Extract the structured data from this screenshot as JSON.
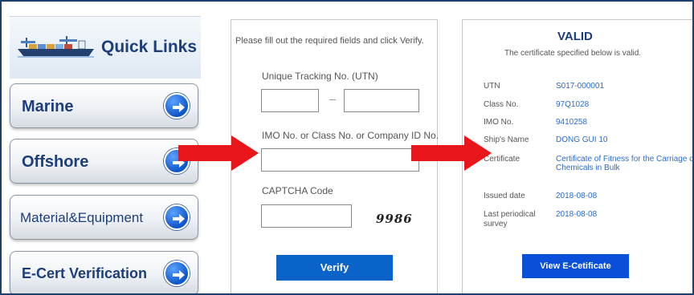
{
  "quick_links": {
    "title": "Quick Links",
    "items": [
      {
        "label": "Marine"
      },
      {
        "label": "Offshore"
      },
      {
        "label": "Material&Equipment"
      },
      {
        "label": "E-Cert Verification"
      }
    ]
  },
  "form": {
    "instruction": "Please fill out the required fields and click Verify.",
    "utn_label": "Unique Tracking No. (UTN)",
    "utn_dash": "–",
    "imo_label": "IMO No. or Class No. or Company ID No.",
    "captcha_label": "CAPTCHA Code",
    "captcha_code": "9986",
    "verify_label": "Verify"
  },
  "result": {
    "status": "VALID",
    "subtitle": "The certificate specified below is valid.",
    "rows": [
      {
        "key": "UTN",
        "value": "S017-000001"
      },
      {
        "key": "Class No.",
        "value": "97Q1028"
      },
      {
        "key": "IMO No.",
        "value": "9410258"
      },
      {
        "key": "Ship's Name",
        "value": "DONG GUI 10"
      },
      {
        "key": "Certificate",
        "value_line1": "Certificate of Fitness for the Carriage of",
        "value_line2": "Chemicals in Bulk"
      },
      {
        "key": "Issued date",
        "value": "2018-08-08"
      },
      {
        "key_line1": "Last periodical",
        "key_line2": "survey",
        "value": "2018-08-08"
      }
    ],
    "view_button_label": "View E-Cetificate"
  },
  "colors": {
    "brand_navy": "#1c3e7a",
    "button_blue": "#0a63c9",
    "link_blue": "#2a6cc9",
    "arrow_red": "#e8161a"
  }
}
